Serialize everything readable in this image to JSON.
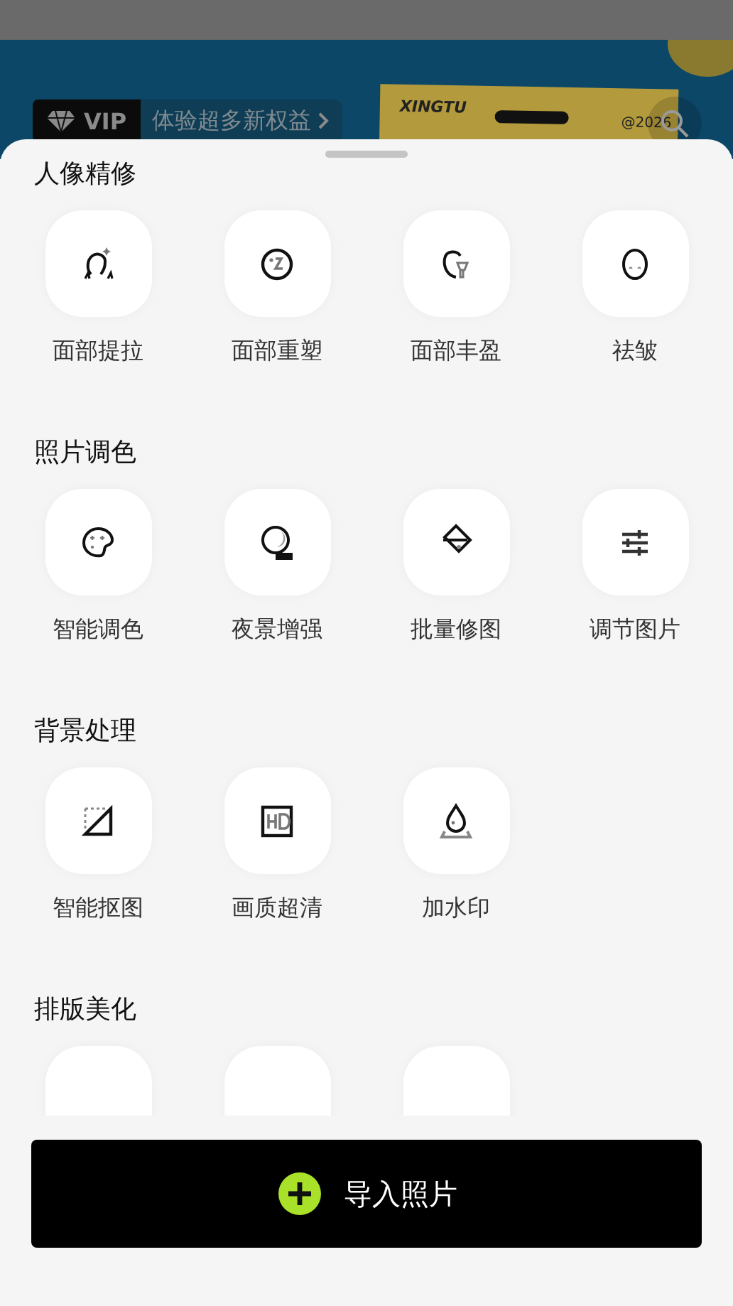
{
  "banner": {
    "vip_badge": "VIP",
    "promo": "体验超多新权益",
    "card_brand": "XINGTU",
    "card_tag": "@2026"
  },
  "sections": [
    {
      "title": "人像精修",
      "tools": [
        {
          "kind": "full",
          "label": "面部提拉"
        },
        {
          "kind": "full",
          "label": "面部重塑"
        },
        {
          "kind": "full",
          "label": "面部丰盈"
        },
        {
          "kind": "full",
          "label": "祛皱"
        }
      ]
    },
    {
      "title": "照片调色",
      "tools": [
        {
          "kind": "full",
          "label": "智能调色"
        },
        {
          "kind": "full",
          "label": "夜景增强"
        },
        {
          "kind": "full",
          "label": "批量修图"
        },
        {
          "kind": "full",
          "label": "调节图片"
        }
      ]
    },
    {
      "title": "背景处理",
      "tools": [
        {
          "kind": "full",
          "label": "智能抠图"
        },
        {
          "kind": "full",
          "label": "画质超清"
        },
        {
          "kind": "full",
          "label": "加水印"
        }
      ]
    },
    {
      "title": "排版美化",
      "tools": [
        {
          "kind": "cut"
        },
        {
          "kind": "cut"
        },
        {
          "kind": "cut"
        }
      ]
    }
  ],
  "import_button": "导入照片"
}
